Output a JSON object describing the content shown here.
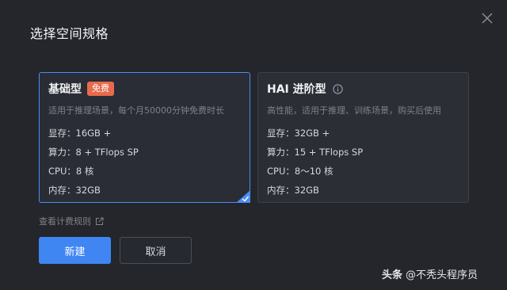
{
  "dialog": {
    "title": "选择空间规格"
  },
  "cards": [
    {
      "name": "基础型",
      "badge": "免费",
      "description": "适用于推理场景，每个月50000分钟免费时长",
      "specs": [
        "显存：16GB +",
        "算力：8 + TFlops SP",
        "CPU：8 核",
        "内存：32GB"
      ],
      "selected": true
    },
    {
      "name": "HAI 进阶型",
      "description": "高性能，适用于推理、训练场景，购买后使用",
      "specs": [
        "显存：32GB +",
        "算力：15 + TFlops SP",
        "CPU：8～10 核",
        "内存：32GB"
      ],
      "selected": false
    }
  ],
  "rules_link": "查看计费规则",
  "buttons": {
    "create": "新建",
    "cancel": "取消"
  },
  "watermark": {
    "brand": "头条",
    "handle": "@不秃头程序员"
  },
  "colors": {
    "background": "#24262c",
    "accent": "#3f86f3",
    "badge": "#e96a4d",
    "selected_border": "#4a8cf7"
  },
  "icons": [
    "close-icon",
    "info-icon",
    "external-link-icon",
    "check-icon"
  ]
}
